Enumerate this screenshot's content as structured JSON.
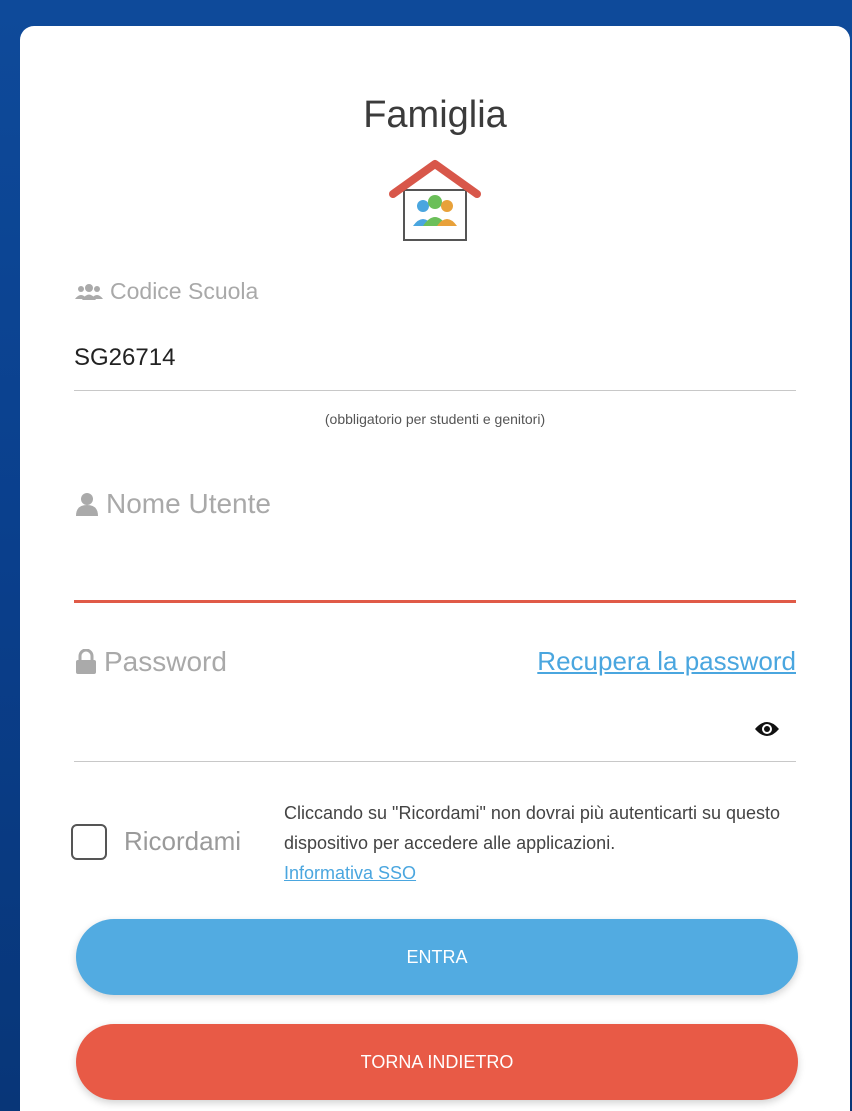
{
  "header": {
    "title": "Famiglia"
  },
  "school": {
    "label": "Codice Scuola",
    "value": "SG26714",
    "hint": "(obbligatorio per studenti e genitori)"
  },
  "username": {
    "label": "Nome Utente",
    "value": ""
  },
  "password": {
    "label": "Password",
    "value": "",
    "recover_label": "Recupera la password"
  },
  "remember": {
    "label": "Ricordami",
    "checked": false,
    "info": "Cliccando su \"Ricordami\" non dovrai più autenticarti su questo dispositivo per accedere alle applicazioni.",
    "sso_link": "Informativa SSO"
  },
  "actions": {
    "enter_label": "ENTRA",
    "back_label": "TORNA INDIETRO"
  },
  "colors": {
    "accent_blue": "#52abe1",
    "accent_red": "#e85a46",
    "link": "#4aa6df",
    "background": "#0e4a9a"
  },
  "icons": {
    "school": "users-icon",
    "user": "user-icon",
    "password": "lock-icon",
    "show_password": "eye-icon",
    "logo": "family-house-icon"
  }
}
